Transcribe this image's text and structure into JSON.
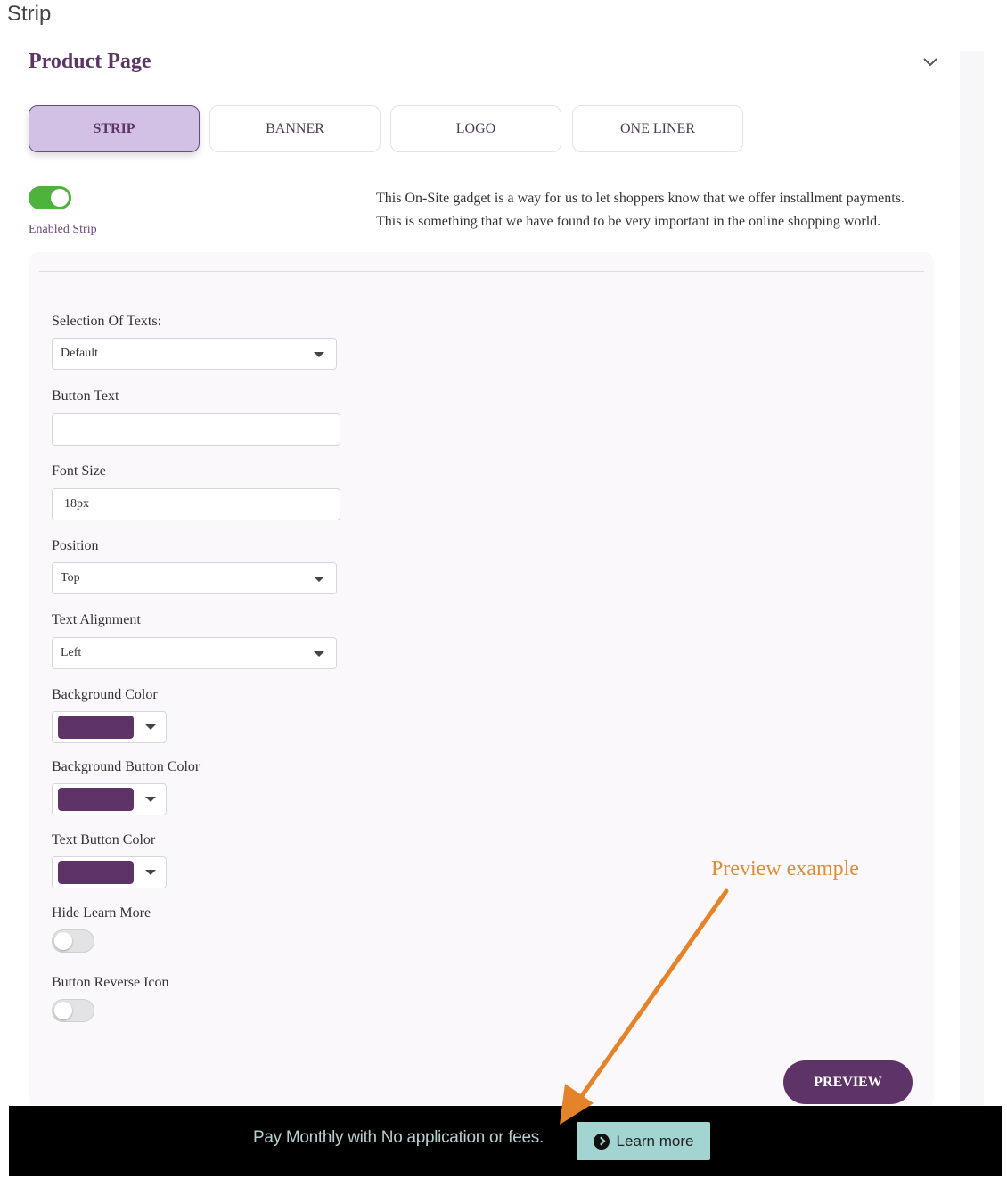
{
  "caption": "Strip",
  "header": {
    "title": "Product Page",
    "collapse_icon": "chevron-down-icon"
  },
  "tabs": [
    {
      "label": "STRIP",
      "active": true
    },
    {
      "label": "BANNER",
      "active": false
    },
    {
      "label": "LOGO",
      "active": false
    },
    {
      "label": "ONE LINER",
      "active": false
    }
  ],
  "enable": {
    "label": "Enabled Strip",
    "on": true
  },
  "description": [
    "This On-Site gadget is a way for us to let shoppers know that we offer installment payments.",
    "This is something that we have found to be very important in the online shopping world."
  ],
  "form": {
    "selection_of_texts": {
      "label": "Selection Of Texts:",
      "value": "Default"
    },
    "button_text": {
      "label": "Button Text",
      "value": ""
    },
    "font_size": {
      "label": "Font Size",
      "value": "18px"
    },
    "position": {
      "label": "Position",
      "value": "Top"
    },
    "text_alignment": {
      "label": "Text Alignment",
      "value": "Left"
    },
    "background_color": {
      "label": "Background Color",
      "value": "#5e3468"
    },
    "background_button_color": {
      "label": "Background Button Color",
      "value": "#5e3468"
    },
    "text_button_color": {
      "label": "Text Button Color",
      "value": "#5e3468"
    },
    "hide_learn_more": {
      "label": "Hide Learn More",
      "on": false
    },
    "button_reverse_icon": {
      "label": "Button Reverse Icon",
      "on": false
    }
  },
  "preview_button": "PREVIEW",
  "annotation": {
    "text": "Preview example",
    "color": "#e5832a"
  },
  "strip_preview": {
    "text": "Pay Monthly with No application or fees.",
    "button": "Learn more",
    "button_icon": "chevron-right-circle-icon",
    "background": "#000000",
    "button_color": "#a2d5d2"
  },
  "colors": {
    "accent": "#5e3468",
    "toggle_on": "#4db33d"
  }
}
